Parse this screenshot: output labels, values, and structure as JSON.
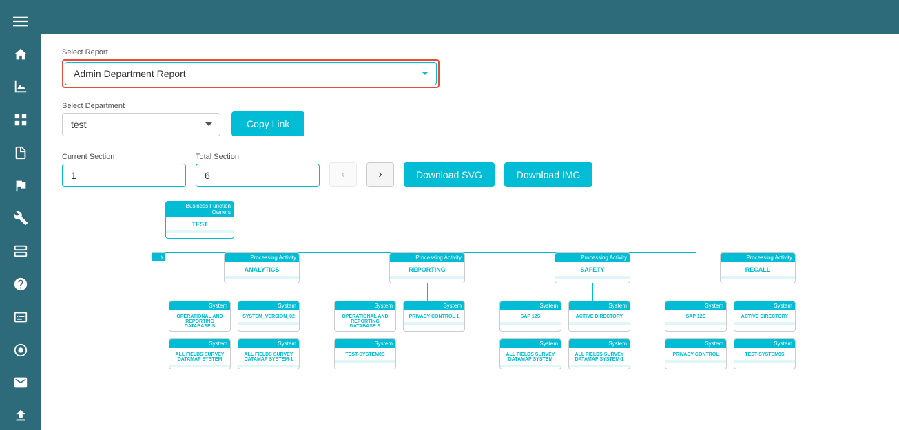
{
  "sidebar": {
    "items": [
      {
        "name": "menu-icon",
        "icon": "menu"
      },
      {
        "name": "home-icon",
        "icon": "home"
      },
      {
        "name": "chart-icon",
        "icon": "chart"
      },
      {
        "name": "grid-icon",
        "icon": "grid"
      },
      {
        "name": "document-icon",
        "icon": "document"
      },
      {
        "name": "flag-icon",
        "icon": "flag"
      },
      {
        "name": "tools-icon",
        "icon": "tools"
      },
      {
        "name": "server-icon",
        "icon": "server"
      },
      {
        "name": "help-icon",
        "icon": "help"
      },
      {
        "name": "news-icon",
        "icon": "news"
      },
      {
        "name": "circle-icon",
        "icon": "circle"
      },
      {
        "name": "mail-icon",
        "icon": "mail"
      },
      {
        "name": "upload-icon",
        "icon": "upload"
      }
    ]
  },
  "header": {
    "title": "Admin Department Report"
  },
  "select_report": {
    "label": "Select Report",
    "value": "Admin Department Report",
    "options": [
      "Admin Department Report"
    ]
  },
  "select_department": {
    "label": "Select Department",
    "value": "test",
    "options": [
      "test"
    ]
  },
  "copy_link": {
    "label": "Copy Link"
  },
  "current_section": {
    "label": "Current Section",
    "value": "1"
  },
  "total_section": {
    "label": "Total Section",
    "value": "6"
  },
  "nav": {
    "prev_label": "‹",
    "next_label": "›"
  },
  "download_svg": {
    "label": "Download SVG"
  },
  "download_img": {
    "label": "Download IMG"
  },
  "diagram": {
    "bfo_card": {
      "header": "Business Function Owners",
      "title": "TEST"
    },
    "pa_cards": [
      {
        "header": "Processing Activity",
        "title": "ANALYTICS"
      },
      {
        "header": "Processing Activity",
        "title": "REPORTING"
      },
      {
        "header": "Processing Activity",
        "title": "SAFETY"
      },
      {
        "header": "Processing Activity",
        "title": "RECALL"
      }
    ],
    "sys_cards": [
      {
        "header": "System",
        "title": "OPERATIONAL AND REPORTING DATABASE S"
      },
      {
        "header": "System",
        "title": "SYSTEM_VERSION_02"
      },
      {
        "header": "System",
        "title": "OPERATIONAL AND REPORTING DATABASE S"
      },
      {
        "header": "System",
        "title": "PRIVACY CONTROL 1"
      },
      {
        "header": "System",
        "title": "SAP 12S"
      },
      {
        "header": "System",
        "title": "ACTIVE DIRECTORY"
      },
      {
        "header": "System",
        "title": "SAP 12S"
      },
      {
        "header": "System",
        "title": "ACTIVE DIRECTORY"
      }
    ],
    "sys_cards2": [
      {
        "header": "System",
        "title": "ALL FIELDS SURVEY DATAMAP SYSTEM"
      },
      {
        "header": "System",
        "title": "ALL FIELDS SURVEY DATAMAP SYSTEM-1"
      },
      {
        "header": "System",
        "title": "TEST-SYSTEM0S"
      },
      {
        "header": "System",
        "title": "ALL FIELDS SURVEY DATAMAP SYSTEM"
      },
      {
        "header": "System",
        "title": "ALL FIELDS SURVEY DATAMAP SYSTEM-1"
      },
      {
        "header": "System",
        "title": "PRIVACY CONTROL"
      },
      {
        "header": "System",
        "title": "TEST-SYSTEM0S"
      }
    ]
  }
}
